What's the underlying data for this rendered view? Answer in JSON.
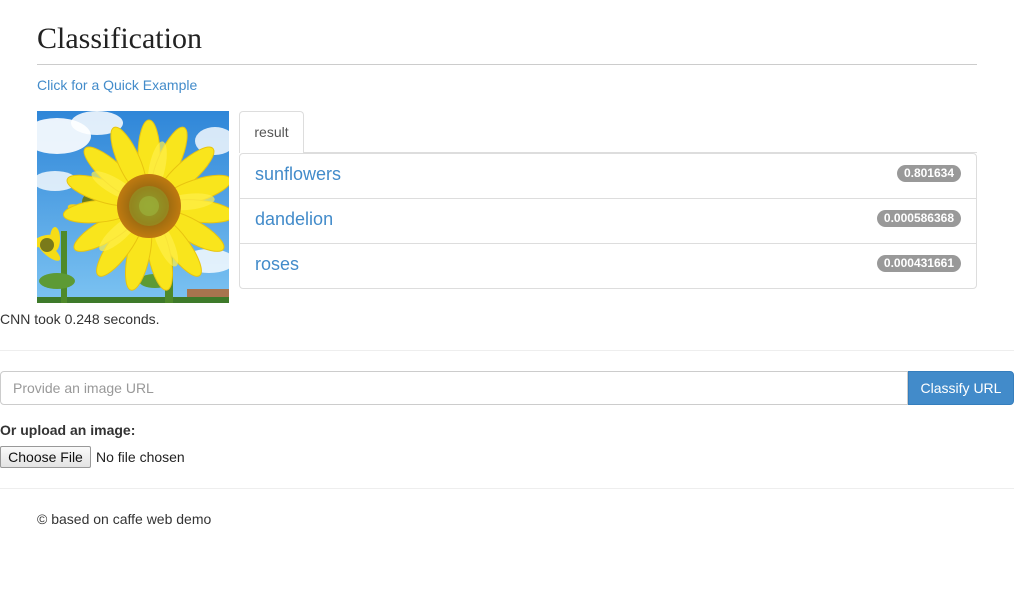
{
  "header": {
    "title": "Classification"
  },
  "quick_example": {
    "label": "Click for a Quick Example"
  },
  "tabs": [
    {
      "label": "result"
    }
  ],
  "results": [
    {
      "label": "sunflowers",
      "score": "0.801634"
    },
    {
      "label": "dandelion",
      "score": "0.000586368"
    },
    {
      "label": "roses",
      "score": "0.000431661"
    }
  ],
  "timing": {
    "text": "CNN took 0.248 seconds."
  },
  "url_form": {
    "placeholder": "Provide an image URL",
    "value": "",
    "button_label": "Classify URL"
  },
  "upload": {
    "label": "Or upload an image:",
    "button_label": "Choose File",
    "status": "No file chosen"
  },
  "footer": {
    "text": "© based on caffe web demo"
  },
  "colors": {
    "link": "#428bca",
    "primary_button": "#428bca",
    "badge": "#999999",
    "petal_yellow": "#f7e21a",
    "sky_blue": "#3f9ae6"
  }
}
